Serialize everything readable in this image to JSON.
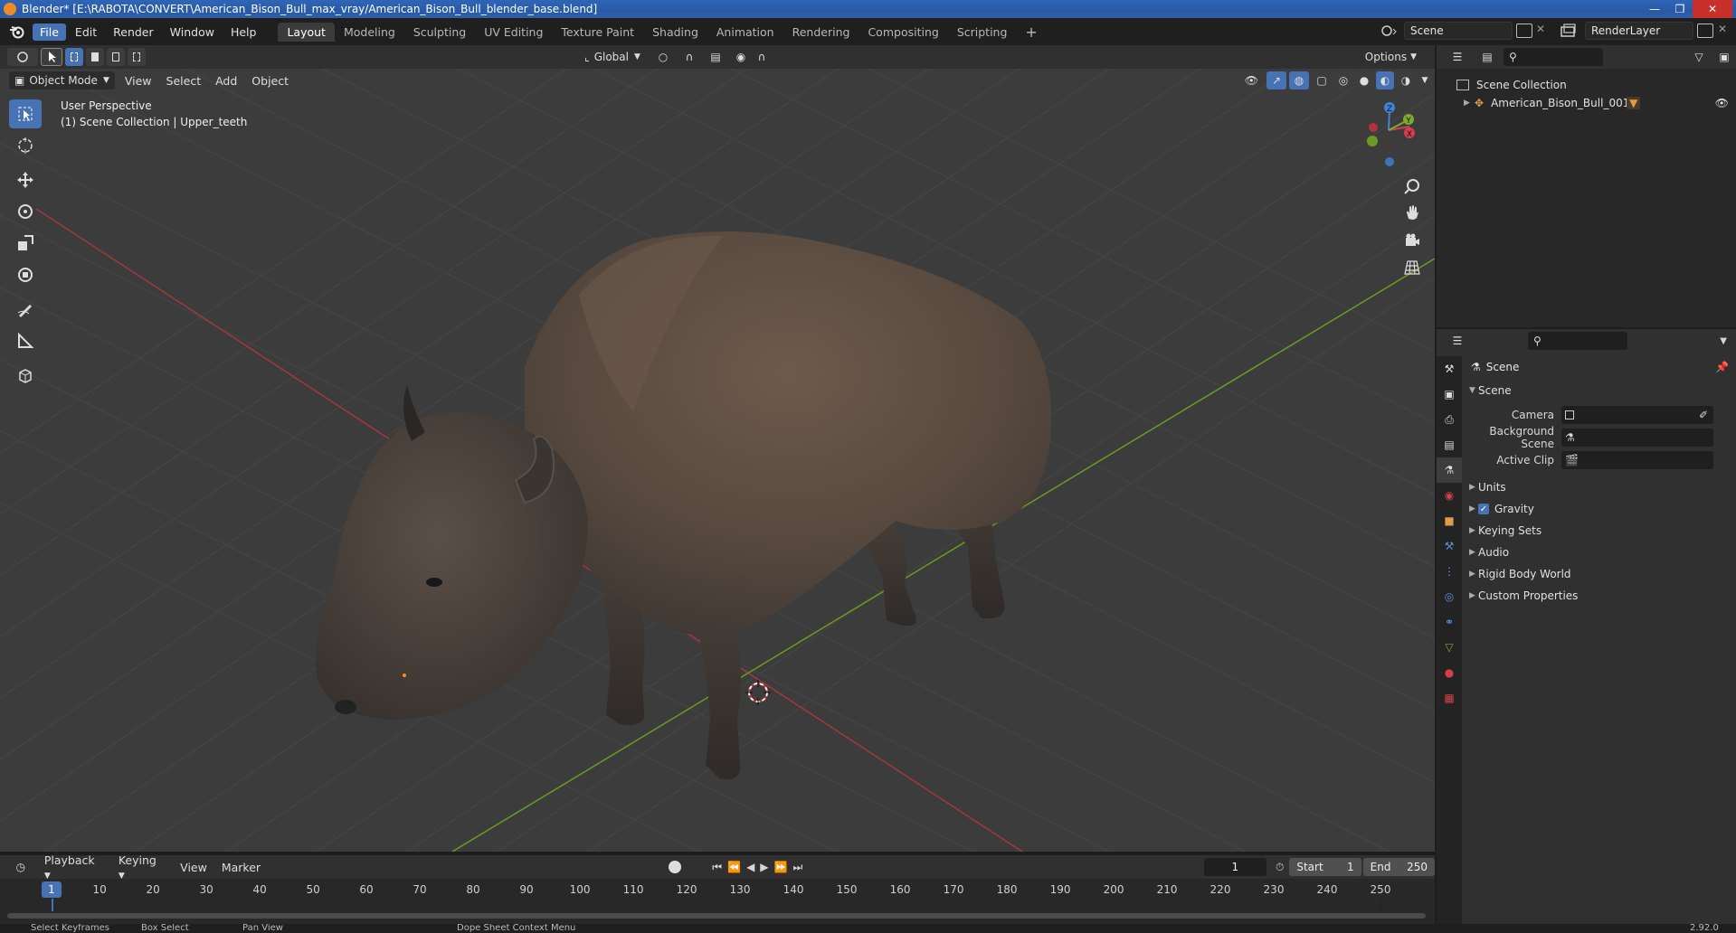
{
  "window": {
    "title": "Blender* [E:\\RABOTA\\CONVERT\\American_Bison_Bull_max_vray/American_Bison_Bull_blender_base.blend]"
  },
  "menu": [
    "File",
    "Edit",
    "Render",
    "Window",
    "Help"
  ],
  "workspaces": [
    "Layout",
    "Modeling",
    "Sculpting",
    "UV Editing",
    "Texture Paint",
    "Shading",
    "Animation",
    "Rendering",
    "Compositing",
    "Scripting"
  ],
  "scene_name": "Scene",
  "render_layer": "RenderLayer",
  "viewport": {
    "transform_orientation": "Global",
    "options_label": "Options",
    "mode": "Object Mode",
    "header_menus": [
      "View",
      "Select",
      "Add",
      "Object"
    ],
    "perspective": "User Perspective",
    "collection_info": "(1) Scene Collection | Upper_teeth"
  },
  "outliner": {
    "root": "Scene Collection",
    "items": [
      "American_Bison_Bull_001"
    ]
  },
  "properties": {
    "context_title": "Scene",
    "panel_title": "Scene",
    "fields": [
      {
        "label": "Camera",
        "value": ""
      },
      {
        "label": "Background Scene",
        "value": ""
      },
      {
        "label": "Active Clip",
        "value": ""
      }
    ],
    "subpanels": [
      "Units",
      "Gravity",
      "Keying Sets",
      "Audio",
      "Rigid Body World",
      "Custom Properties"
    ]
  },
  "timeline": {
    "menus": [
      "Playback",
      "Keying",
      "View",
      "Marker"
    ],
    "current_frame": "1",
    "start_label": "Start",
    "start": "1",
    "end_label": "End",
    "end": "250",
    "ruler": [
      "1",
      "10",
      "20",
      "30",
      "40",
      "50",
      "60",
      "70",
      "80",
      "90",
      "100",
      "110",
      "120",
      "130",
      "140",
      "150",
      "160",
      "170",
      "180",
      "190",
      "200",
      "210",
      "220",
      "230",
      "240",
      "250"
    ]
  },
  "statusbar": {
    "items": [
      "Select Keyframes",
      "Box Select",
      "Pan View",
      "Dope Sheet Context Menu"
    ],
    "version": "2.92.0"
  },
  "colors": {
    "accent": "#4772b3",
    "x_axis": "#d3404c",
    "y_axis": "#7bab2a",
    "z_axis": "#3f84d6"
  }
}
